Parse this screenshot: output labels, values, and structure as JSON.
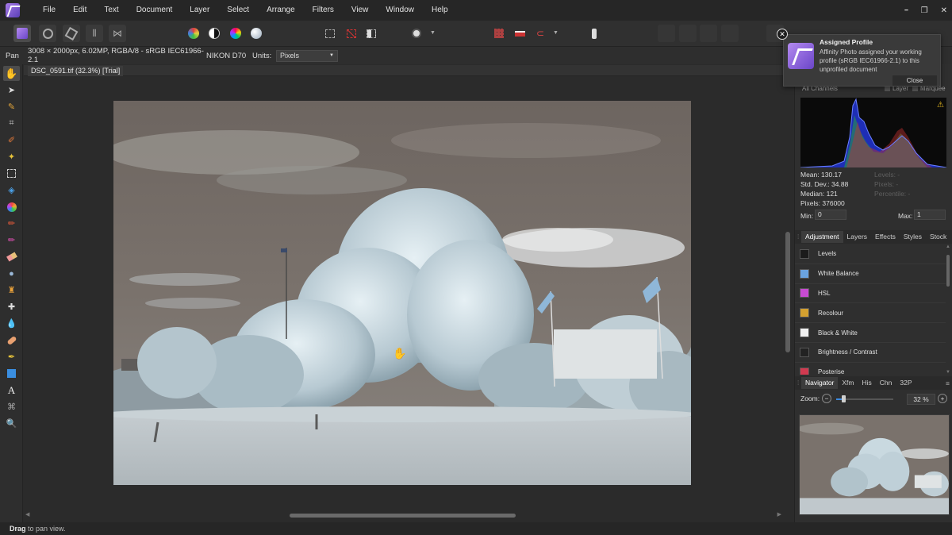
{
  "menubar": {
    "items": [
      "File",
      "Edit",
      "Text",
      "Document",
      "Layer",
      "Select",
      "Arrange",
      "Filters",
      "View",
      "Window",
      "Help"
    ],
    "window_controls": {
      "minimize": "━",
      "restore": "❐",
      "close": "✕"
    }
  },
  "context_bar": {
    "tool": "Pan",
    "document_info": "3008 × 2000px, 6.02MP, RGBA/8 - sRGB IEC61966-2.1",
    "camera": "NIKON D70",
    "units_label": "Units:",
    "units_value": "Pixels"
  },
  "document": {
    "tab_label": "DSC_0591.tif (32.3%) [Trial]"
  },
  "histogram": {
    "channel_select": "All Channels",
    "layer_label": "Layer",
    "marquee_label": "Marquee",
    "warning_icon": "warning-icon",
    "stats": {
      "mean": "Mean: 130.17",
      "std_dev": "Std. Dev.: 34.88",
      "median": "Median: 121",
      "pixels": "Pixels: 376000",
      "levels": "Levels: -",
      "pixels_sel": "Pixels: -",
      "percentile": "Percentile: -"
    },
    "min_label": "Min:",
    "min_value": "0",
    "max_label": "Max:",
    "max_value": "1"
  },
  "adjustment_panel": {
    "tabs": [
      "Adjustment",
      "Layers",
      "Effects",
      "Styles",
      "Stock"
    ],
    "active_tab": "Adjustment",
    "items": [
      {
        "label": "Levels",
        "color": "#1b1b1b"
      },
      {
        "label": "White Balance",
        "color": "#6aa3e0"
      },
      {
        "label": "HSL",
        "color": "#c74bd1"
      },
      {
        "label": "Recolour",
        "color": "#d3a030"
      },
      {
        "label": "Black & White",
        "color": "#f0f0f0"
      },
      {
        "label": "Brightness / Contrast",
        "color": "#222222"
      },
      {
        "label": "Posterise",
        "color": "#d23a50"
      }
    ]
  },
  "navigator_panel": {
    "tabs": [
      "Navigator",
      "Xfm",
      "His",
      "Chn",
      "32P"
    ],
    "active_tab": "Navigator",
    "zoom_label": "Zoom:",
    "zoom_value": "32 %",
    "zoom_level": 0.12
  },
  "notification": {
    "title": "Assigned Profile",
    "body": "Affinity Photo assigned your working profile (sRGB IEC61966-2.1) to this unprofiled document",
    "close_label": "Close"
  },
  "status_bar": {
    "action": "Drag",
    "hint": " to pan view."
  },
  "colors": {
    "accent": "#3c8ae0",
    "brand": "#7b55d6"
  }
}
